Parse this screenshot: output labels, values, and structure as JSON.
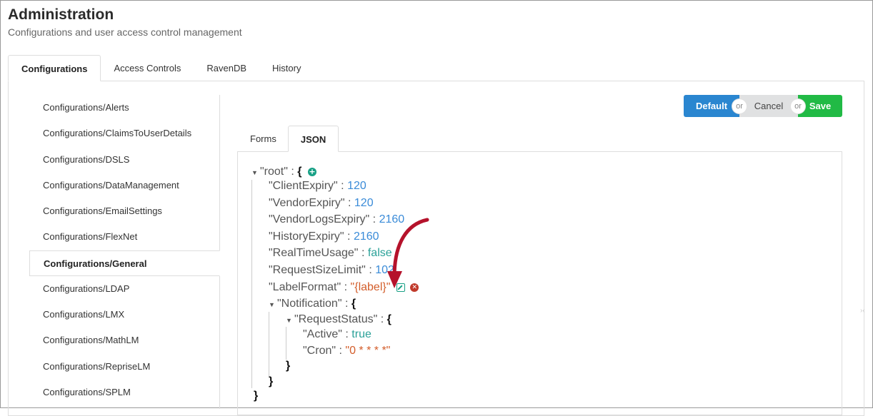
{
  "header": {
    "title": "Administration",
    "subtitle": "Configurations and user access control management"
  },
  "main_tabs": [
    {
      "label": "Configurations",
      "active": true
    },
    {
      "label": "Access Controls",
      "active": false
    },
    {
      "label": "RavenDB",
      "active": false
    },
    {
      "label": "History",
      "active": false
    }
  ],
  "sidebar": {
    "items": [
      {
        "label": "Configurations/Alerts"
      },
      {
        "label": "Configurations/ClaimsToUserDetails"
      },
      {
        "label": "Configurations/DSLS"
      },
      {
        "label": "Configurations/DataManagement"
      },
      {
        "label": "Configurations/EmailSettings"
      },
      {
        "label": "Configurations/FlexNet"
      },
      {
        "label": "Configurations/General",
        "active": true
      },
      {
        "label": "Configurations/LDAP"
      },
      {
        "label": "Configurations/LMX"
      },
      {
        "label": "Configurations/MathLM"
      },
      {
        "label": "Configurations/RepriseLM"
      },
      {
        "label": "Configurations/SPLM"
      }
    ]
  },
  "actions": {
    "default_label": "Default",
    "cancel_label": "Cancel",
    "save_label": "Save",
    "or_label": "or",
    "colors": {
      "default": "#2a86d0",
      "cancel": "#e0e1e2",
      "save": "#21ba45"
    }
  },
  "sub_tabs": [
    {
      "label": "Forms",
      "active": false
    },
    {
      "label": "JSON",
      "active": true
    }
  ],
  "json_tree": {
    "root_key": "\"root\"",
    "open_brace": "{",
    "close_brace": "}",
    "sep": ":",
    "fields": [
      {
        "key": "\"ClientExpiry\"",
        "value": "120",
        "type": "num"
      },
      {
        "key": "\"VendorExpiry\"",
        "value": "120",
        "type": "num"
      },
      {
        "key": "\"VendorLogsExpiry\"",
        "value": "2160",
        "type": "num"
      },
      {
        "key": "\"HistoryExpiry\"",
        "value": "2160",
        "type": "num"
      },
      {
        "key": "\"RealTimeUsage\"",
        "value": "false",
        "type": "bool"
      },
      {
        "key": "\"RequestSizeLimit\"",
        "value": "102",
        "type": "num"
      },
      {
        "key": "\"LabelFormat\"",
        "value": "\"{label}\"",
        "type": "str"
      }
    ],
    "notification_key": "\"Notification\"",
    "request_status_key": "\"RequestStatus\"",
    "active_key": "\"Active\"",
    "active_value": "true",
    "cron_key": "\"Cron\"",
    "cron_value": "\"0 * * * *\""
  },
  "icons": {
    "add": "plus-circle-icon",
    "edit": "edit-icon",
    "remove": "remove-circle-icon",
    "annotation_arrow": "red-arrow-annotation"
  }
}
